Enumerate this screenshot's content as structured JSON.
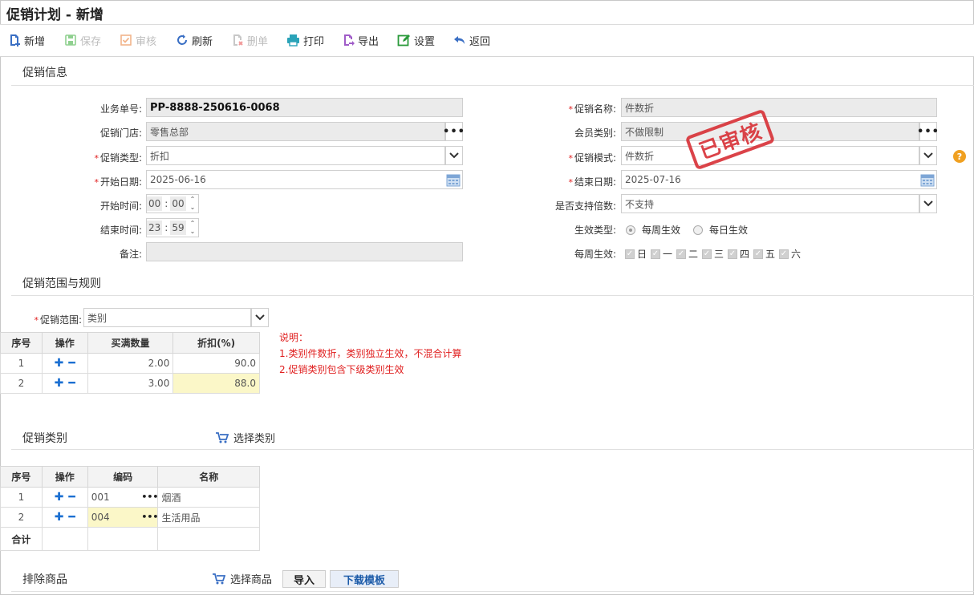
{
  "page": {
    "title": "促销计划 - 新增"
  },
  "toolbar": {
    "new": "新增",
    "save": "保存",
    "audit": "审核",
    "refresh": "刷新",
    "delete": "删单",
    "print": "打印",
    "export": "导出",
    "settings": "设置",
    "back": "返回"
  },
  "sections": {
    "info": "促销信息",
    "scope": "促销范围与规则",
    "category": "促销类别",
    "exclude": "排除商品"
  },
  "form": {
    "doc_no": {
      "label": "业务单号:",
      "value": "PP-8888-250616-0068"
    },
    "store": {
      "label": "促销门店:",
      "value": "零售总部"
    },
    "promo_type": {
      "label": "促销类型:",
      "value": "折扣"
    },
    "start_date": {
      "label": "开始日期:",
      "value": "2025-06-16"
    },
    "start_time": {
      "label": "开始时间:",
      "hh": "00",
      "mm": "00"
    },
    "end_time": {
      "label": "结束时间:",
      "hh": "23",
      "mm": "59"
    },
    "remark": {
      "label": "备注:",
      "value": ""
    },
    "promo_name": {
      "label": "促销名称:",
      "value": "件数折"
    },
    "member_type": {
      "label": "会员类别:",
      "value": "不做限制"
    },
    "promo_mode": {
      "label": "促销模式:",
      "value": "件数折"
    },
    "end_date": {
      "label": "结束日期:",
      "value": "2025-07-16"
    },
    "multiple": {
      "label": "是否支持倍数:",
      "value": "不支持"
    },
    "effect_type": {
      "label": "生效类型:",
      "weekly": "每周生效",
      "daily": "每日生效"
    },
    "weekly": {
      "label": "每周生效:",
      "days": [
        "日",
        "一",
        "二",
        "三",
        "四",
        "五",
        "六"
      ]
    }
  },
  "stamp": "已审核",
  "scope": {
    "label": "促销范围:",
    "value": "类别",
    "columns": [
      "序号",
      "操作",
      "买满数量",
      "折扣(%)"
    ],
    "rows": [
      {
        "no": "1",
        "qty": "2.00",
        "discount": "90.0"
      },
      {
        "no": "2",
        "qty": "3.00",
        "discount": "88.0"
      }
    ],
    "note_title": "说明：",
    "note_lines": [
      "1.类别件数折，类别独立生效，不混合计算",
      "2.促销类别包含下级类别生效"
    ]
  },
  "category": {
    "select_label": "选择类别",
    "columns": [
      "序号",
      "操作",
      "编码",
      "名称"
    ],
    "rows": [
      {
        "no": "1",
        "code": "001",
        "name": "烟酒"
      },
      {
        "no": "2",
        "code": "004",
        "name": "生活用品"
      }
    ],
    "total_label": "合计"
  },
  "exclude": {
    "select_label": "选择商品",
    "import_label": "导入",
    "download_label": "下载模板"
  },
  "colors": {
    "required": "#e02020",
    "stamp": "#d8343a",
    "highlight": "#fbf7c8",
    "op": "#1b6fd1"
  }
}
